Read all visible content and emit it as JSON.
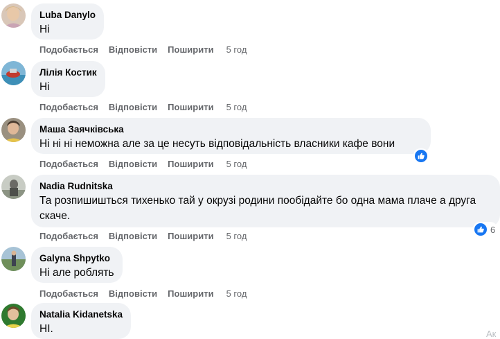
{
  "actions": {
    "like_label": "Подобається",
    "reply_label": "Відповісти",
    "share_label": "Поширити"
  },
  "colors": {
    "bubble_bg": "#f0f2f5",
    "action_text": "#65676b",
    "like_blue": "#1877f2"
  },
  "comments": [
    {
      "author": "Luba Danylo",
      "text": "Ні",
      "time": "5 год"
    },
    {
      "author": "Лілія Костик",
      "text": "Ні",
      "time": "5 год"
    },
    {
      "author": "Маша Заячківська",
      "text": "Ні ні ні неможна але за це несуть відповідальність власники кафе вони",
      "time": "5 год",
      "reaction_icon": "like-icon"
    },
    {
      "author": "Nadia Rudnitska",
      "text": "Та розпишишться тихенько тай у окрузі родини пообідайте бо одна мама плаче а друга скаче.",
      "time": "5 год",
      "reaction_icon": "like-icon",
      "reaction_count": "6"
    },
    {
      "author": "Galyna Shpytko",
      "text": "Ні але роблять",
      "time": "5 год"
    },
    {
      "author": "Natalia Kidanetska",
      "text": "НІ."
    }
  ],
  "corner_text": "Ак"
}
